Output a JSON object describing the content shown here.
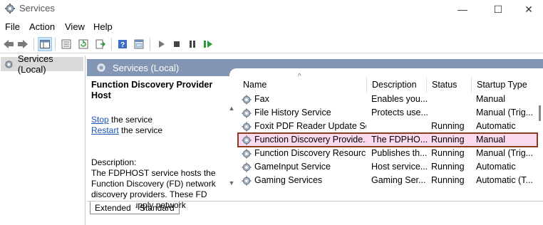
{
  "window": {
    "title": "Services",
    "controls": {
      "minimize": "—",
      "maximize": "☐",
      "close": "✕"
    }
  },
  "menu": [
    "File",
    "Action",
    "View",
    "Help"
  ],
  "toolbar": {
    "buttons": [
      "back-icon",
      "forward-icon",
      "show-hide-tree-icon",
      "properties-icon",
      "refresh-icon",
      "export-list-icon",
      "help-icon",
      "mmc-console-icon",
      "start-service-icon",
      "stop-service-icon",
      "pause-service-icon",
      "resume-service-icon"
    ]
  },
  "tree": {
    "root_label": "Services (Local)"
  },
  "main": {
    "header_label": "Services (Local)",
    "details": {
      "service_title": "Function Discovery Provider Host",
      "stop_link": "Stop",
      "stop_suffix": " the service",
      "restart_link": "Restart",
      "restart_suffix": " the service",
      "description_label": "Description:",
      "description_text": "The FDPHOST service hosts the Function Discovery (FD) network discovery providers. These FD providers supply network"
    },
    "columns": [
      "Name",
      "Description",
      "Status",
      "Startup Type"
    ],
    "rows": [
      {
        "name": "Fax",
        "description": "Enables you...",
        "status": "",
        "startup": "Manual"
      },
      {
        "name": "File History Service",
        "description": "Protects use...",
        "status": "",
        "startup": "Manual (Trig..."
      },
      {
        "name": "Foxit PDF Reader Update Se...",
        "description": "",
        "status": "Running",
        "startup": "Automatic"
      },
      {
        "name": "Function Discovery Provide...",
        "description": "The FDPHO...",
        "status": "Running",
        "startup": "Manual"
      },
      {
        "name": "Function Discovery Resourc...",
        "description": "Publishes th...",
        "status": "Running",
        "startup": "Manual (Trig..."
      },
      {
        "name": "GameInput Service",
        "description": "Host service...",
        "status": "Running",
        "startup": "Automatic"
      },
      {
        "name": "Gaming Services",
        "description": "Gaming Ser...",
        "status": "Running",
        "startup": "Automatic (T..."
      }
    ],
    "selected_row_index": 3,
    "selection_border_color": "#8b3b1e",
    "selection_fill_color": "#fcd9ee"
  },
  "tabs": [
    "Extended",
    "Standard"
  ],
  "colors": {
    "header_bar": "#8396b4",
    "link": "#1a55b5"
  }
}
